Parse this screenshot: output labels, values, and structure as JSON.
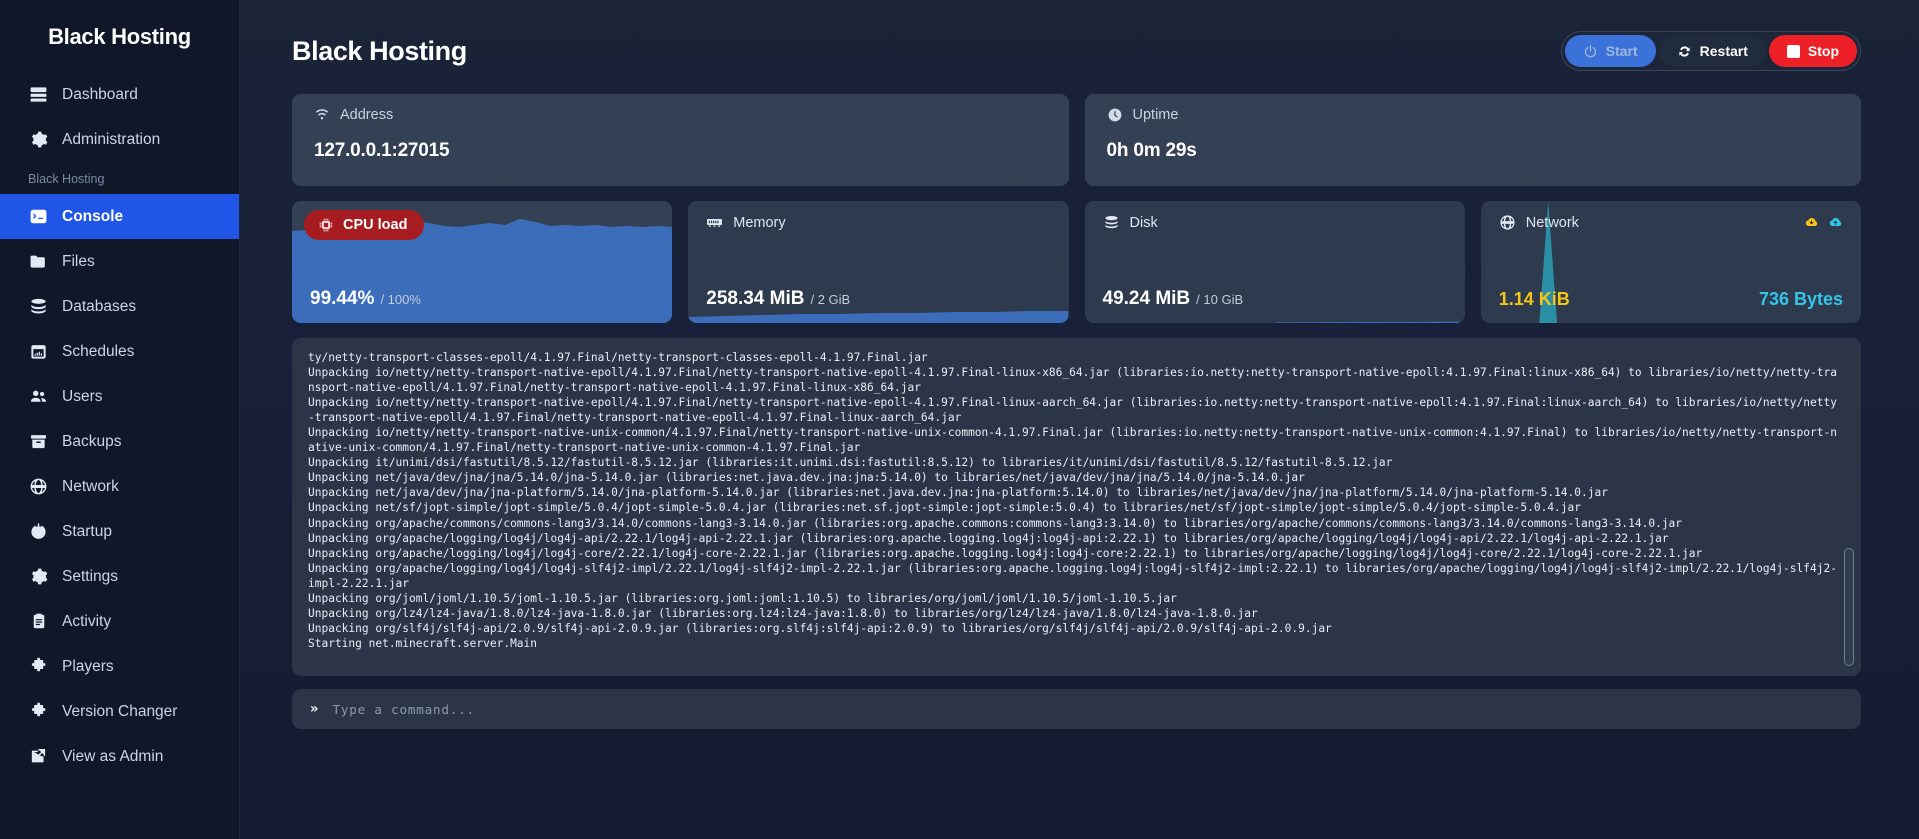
{
  "sidebar": {
    "brand": "Black Hosting",
    "top_items": [
      {
        "label": "Dashboard",
        "icon": "server-icon"
      },
      {
        "label": "Administration",
        "icon": "gear-icon"
      }
    ],
    "section_label": "Black Hosting",
    "items": [
      {
        "label": "Console",
        "icon": "terminal-icon",
        "active": true
      },
      {
        "label": "Files",
        "icon": "folder-icon",
        "active": false
      },
      {
        "label": "Databases",
        "icon": "database-icon",
        "active": false
      },
      {
        "label": "Schedules",
        "icon": "calendar-icon",
        "active": false
      },
      {
        "label": "Users",
        "icon": "users-icon",
        "active": false
      },
      {
        "label": "Backups",
        "icon": "archive-icon",
        "active": false
      },
      {
        "label": "Network",
        "icon": "globe-icon",
        "active": false
      },
      {
        "label": "Startup",
        "icon": "power-icon",
        "active": false
      },
      {
        "label": "Settings",
        "icon": "gear-icon",
        "active": false
      },
      {
        "label": "Activity",
        "icon": "clipboard-icon",
        "active": false
      },
      {
        "label": "Players",
        "icon": "puzzle-icon",
        "active": false
      },
      {
        "label": "Version Changer",
        "icon": "puzzle-icon",
        "active": false
      },
      {
        "label": "View as Admin",
        "icon": "external-link-icon",
        "active": false
      }
    ]
  },
  "header": {
    "title": "Black Hosting",
    "buttons": {
      "start": "Start",
      "restart": "Restart",
      "stop": "Stop"
    }
  },
  "info_cards": [
    {
      "label": "Address",
      "icon": "wifi-icon",
      "value": "127.0.0.1:27015"
    },
    {
      "label": "Uptime",
      "icon": "clock-icon",
      "value": "0h 0m 29s"
    }
  ],
  "stats": {
    "cpu": {
      "label": "CPU load",
      "icon": "cpu-icon",
      "value": "99.44%",
      "limit": "/ 100%",
      "alert": true,
      "alert_color": "#a61c21",
      "fill_color": "#3c6dba"
    },
    "memory": {
      "label": "Memory",
      "icon": "memory-icon",
      "value": "258.34 MiB",
      "limit": "/ 2 GiB",
      "fill_color": "#3c6dba"
    },
    "disk": {
      "label": "Disk",
      "icon": "disk-icon",
      "value": "49.24 MiB",
      "limit": "/ 10 GiB",
      "fill_color": "#3c6dba"
    },
    "network": {
      "label": "Network",
      "icon": "globe-icon",
      "download": "1.14 KiB",
      "upload": "736 Bytes",
      "download_color": "#f5c518",
      "upload_color": "#35c5e8",
      "chart_color": "#2a8fa4"
    }
  },
  "console": {
    "log": "ty/netty-transport-classes-epoll/4.1.97.Final/netty-transport-classes-epoll-4.1.97.Final.jar\nUnpacking io/netty/netty-transport-native-epoll/4.1.97.Final/netty-transport-native-epoll-4.1.97.Final-linux-x86_64.jar (libraries:io.netty:netty-transport-native-epoll:4.1.97.Final:linux-x86_64) to libraries/io/netty/netty-transport-native-epoll/4.1.97.Final/netty-transport-native-epoll-4.1.97.Final-linux-x86_64.jar\nUnpacking io/netty/netty-transport-native-epoll/4.1.97.Final/netty-transport-native-epoll-4.1.97.Final-linux-aarch_64.jar (libraries:io.netty:netty-transport-native-epoll:4.1.97.Final:linux-aarch_64) to libraries/io/netty/netty-transport-native-epoll/4.1.97.Final/netty-transport-native-epoll-4.1.97.Final-linux-aarch_64.jar\nUnpacking io/netty/netty-transport-native-unix-common/4.1.97.Final/netty-transport-native-unix-common-4.1.97.Final.jar (libraries:io.netty:netty-transport-native-unix-common:4.1.97.Final) to libraries/io/netty/netty-transport-native-unix-common/4.1.97.Final/netty-transport-native-unix-common-4.1.97.Final.jar\nUnpacking it/unimi/dsi/fastutil/8.5.12/fastutil-8.5.12.jar (libraries:it.unimi.dsi:fastutil:8.5.12) to libraries/it/unimi/dsi/fastutil/8.5.12/fastutil-8.5.12.jar\nUnpacking net/java/dev/jna/jna/5.14.0/jna-5.14.0.jar (libraries:net.java.dev.jna:jna:5.14.0) to libraries/net/java/dev/jna/jna/5.14.0/jna-5.14.0.jar\nUnpacking net/java/dev/jna/jna-platform/5.14.0/jna-platform-5.14.0.jar (libraries:net.java.dev.jna:jna-platform:5.14.0) to libraries/net/java/dev/jna/jna-platform/5.14.0/jna-platform-5.14.0.jar\nUnpacking net/sf/jopt-simple/jopt-simple/5.0.4/jopt-simple-5.0.4.jar (libraries:net.sf.jopt-simple:jopt-simple:5.0.4) to libraries/net/sf/jopt-simple/jopt-simple/5.0.4/jopt-simple-5.0.4.jar\nUnpacking org/apache/commons/commons-lang3/3.14.0/commons-lang3-3.14.0.jar (libraries:org.apache.commons:commons-lang3:3.14.0) to libraries/org/apache/commons/commons-lang3/3.14.0/commons-lang3-3.14.0.jar\nUnpacking org/apache/logging/log4j/log4j-api/2.22.1/log4j-api-2.22.1.jar (libraries:org.apache.logging.log4j:log4j-api:2.22.1) to libraries/org/apache/logging/log4j/log4j-api/2.22.1/log4j-api-2.22.1.jar\nUnpacking org/apache/logging/log4j/log4j-core/2.22.1/log4j-core-2.22.1.jar (libraries:org.apache.logging.log4j:log4j-core:2.22.1) to libraries/org/apache/logging/log4j/log4j-core/2.22.1/log4j-core-2.22.1.jar\nUnpacking org/apache/logging/log4j/log4j-slf4j2-impl/2.22.1/log4j-slf4j2-impl-2.22.1.jar (libraries:org.apache.logging.log4j:log4j-slf4j2-impl:2.22.1) to libraries/org/apache/logging/log4j/log4j-slf4j2-impl/2.22.1/log4j-slf4j2-impl-2.22.1.jar\nUnpacking org/joml/joml/1.10.5/joml-1.10.5.jar (libraries:org.joml:joml:1.10.5) to libraries/org/joml/joml/1.10.5/joml-1.10.5.jar\nUnpacking org/lz4/lz4-java/1.8.0/lz4-java-1.8.0.jar (libraries:org.lz4:lz4-java:1.8.0) to libraries/org/lz4/lz4-java/1.8.0/lz4-java-1.8.0.jar\nUnpacking org/slf4j/slf4j-api/2.0.9/slf4j-api-2.0.9.jar (libraries:org.slf4j:slf4j-api:2.0.9) to libraries/org/slf4j/slf4j-api/2.0.9/slf4j-api-2.0.9.jar\nStarting net.minecraft.server.Main",
    "input_value": "",
    "input_placeholder": "Type a command...",
    "prompt": "»"
  }
}
